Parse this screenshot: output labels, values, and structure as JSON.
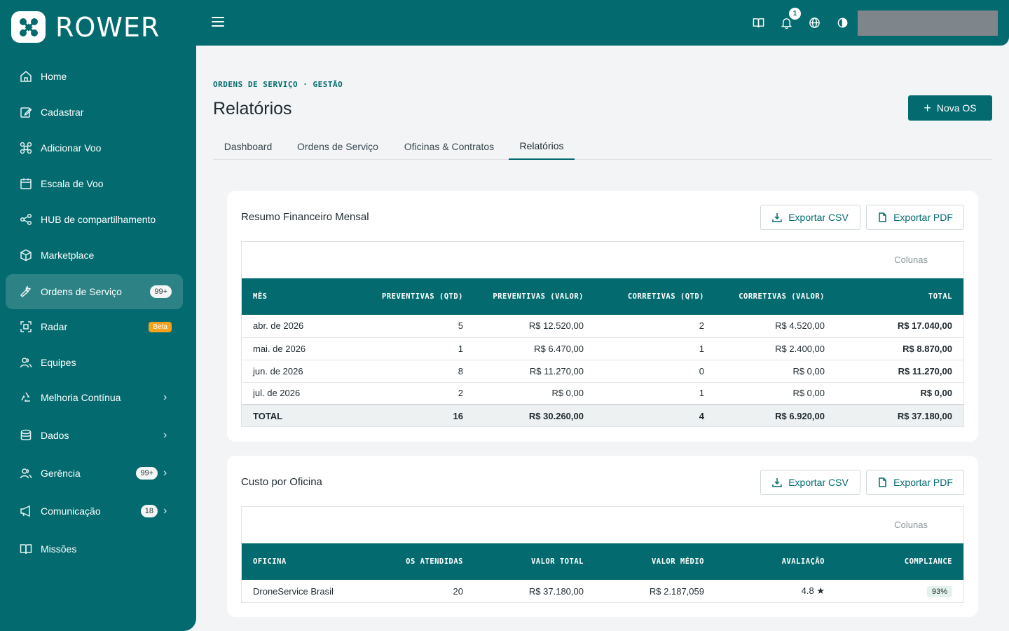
{
  "brand": {
    "name": "ROWER"
  },
  "sidebar": {
    "items": [
      {
        "label": "Home",
        "icon": "home-icon"
      },
      {
        "label": "Cadastrar",
        "icon": "edit-icon"
      },
      {
        "label": "Adicionar Voo",
        "icon": "drone-icon"
      },
      {
        "label": "Escala de Voo",
        "icon": "calendar-icon"
      },
      {
        "label": "HUB de compartilhamento",
        "icon": "share-icon"
      },
      {
        "label": "Marketplace",
        "icon": "box-icon"
      },
      {
        "label": "Ordens de Serviço",
        "icon": "wrench-icon",
        "badge": "99+",
        "active": true
      },
      {
        "label": "Radar",
        "icon": "radar-icon",
        "beta": "Beta"
      },
      {
        "label": "Equipes",
        "icon": "users-icon"
      },
      {
        "label": "Melhoria Contínua",
        "icon": "recycle-icon",
        "chevron": true
      },
      {
        "label": "Dados",
        "icon": "database-icon",
        "chevron": true
      },
      {
        "label": "Gerência",
        "icon": "users-icon",
        "badge": "99+",
        "chevron": true
      },
      {
        "label": "Comunicação",
        "icon": "megaphone-icon",
        "badge": "18",
        "chevron": true
      },
      {
        "label": "Missões",
        "icon": "book-icon"
      }
    ]
  },
  "topbar": {
    "notifications": "1"
  },
  "header": {
    "breadcrumb": "ORDENS DE SERVIÇO · GESTÃO",
    "title": "Relatórios",
    "new_button": "Nova OS"
  },
  "tabs": [
    "Dashboard",
    "Ordens de Serviço",
    "Oficinas & Contratos",
    "Relatórios"
  ],
  "export": {
    "csv": "Exportar CSV",
    "pdf": "Exportar PDF",
    "columns": "Colunas"
  },
  "resumo": {
    "title": "Resumo Financeiro Mensal",
    "headers": [
      "MÊS",
      "PREVENTIVAS (QTD)",
      "PREVENTIVAS (VALOR)",
      "CORRETIVAS (QTD)",
      "CORRETIVAS (VALOR)",
      "TOTAL"
    ],
    "rows": [
      [
        "abr. de 2026",
        "5",
        "R$ 12.520,00",
        "2",
        "R$ 4.520,00",
        "R$ 17.040,00"
      ],
      [
        "mai. de 2026",
        "1",
        "R$ 6.470,00",
        "1",
        "R$ 2.400,00",
        "R$ 8.870,00"
      ],
      [
        "jun. de 2026",
        "8",
        "R$ 11.270,00",
        "0",
        "R$ 0,00",
        "R$ 11.270,00"
      ],
      [
        "jul. de 2026",
        "2",
        "R$ 0,00",
        "1",
        "R$ 0,00",
        "R$ 0,00"
      ]
    ],
    "total": [
      "TOTAL",
      "16",
      "R$ 30.260,00",
      "4",
      "R$ 6.920,00",
      "R$ 37.180,00"
    ]
  },
  "custo": {
    "title": "Custo por Oficina",
    "headers": [
      "OFICINA",
      "OS ATENDIDAS",
      "VALOR TOTAL",
      "VALOR MÉDIO",
      "AVALIAÇÃO",
      "COMPLIANCE"
    ],
    "rows": [
      [
        "DroneService Brasil",
        "20",
        "R$ 37.180,00",
        "R$ 2.187,059",
        "4.8 ★",
        "93%"
      ]
    ]
  }
}
